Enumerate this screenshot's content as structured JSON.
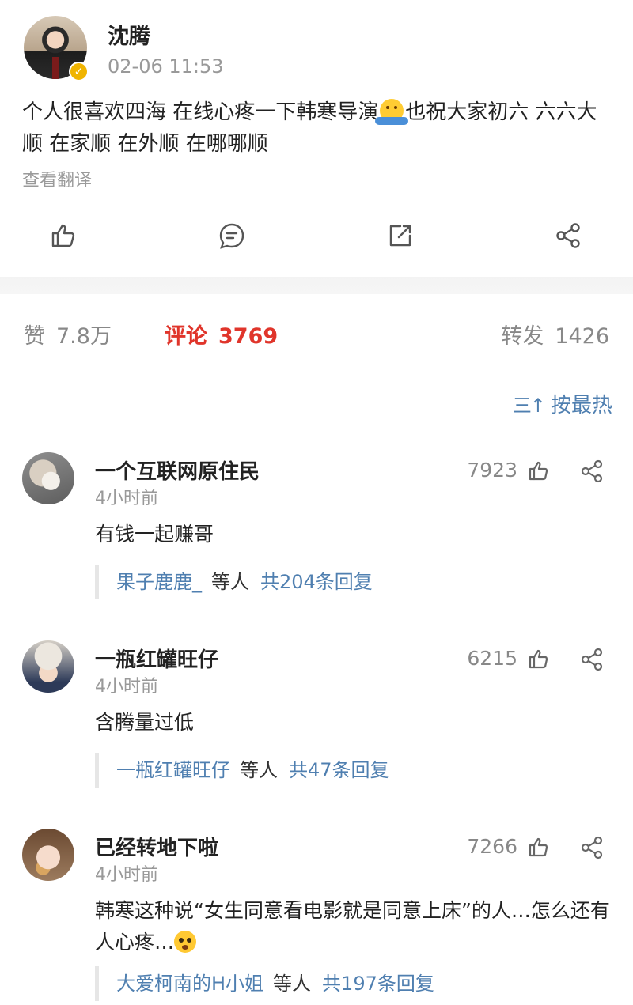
{
  "post": {
    "author": "沈腾",
    "time": "02-06 11:53",
    "text_before_emoji": "个人很喜欢四海 在线心疼一下韩寒导演",
    "text_after_emoji": "也祝大家初六 六六大顺 在家顺 在外顺 在哪哪顺",
    "translate_link": "查看翻译"
  },
  "stats": {
    "likes_label": "赞",
    "likes_count": "7.8万",
    "comments_label": "评论",
    "comments_count": "3769",
    "reposts_label": "转发",
    "reposts_count": "1426"
  },
  "sort": {
    "label": "按最热",
    "icon_text": "三↑"
  },
  "comments": [
    {
      "name": "一个互联网原住民",
      "time": "4小时前",
      "likes": "7923",
      "text": "有钱一起赚哥",
      "reply_user": "果子鹿鹿_",
      "reply_mid": "等人",
      "reply_total": "共204条回复"
    },
    {
      "name": "一瓶红罐旺仔",
      "time": "4小时前",
      "likes": "6215",
      "text": "含腾量过低",
      "reply_user": "一瓶红罐旺仔",
      "reply_mid": "等人",
      "reply_total": "共47条回复"
    },
    {
      "name": "已经转地下啦",
      "time": "4小时前",
      "likes": "7266",
      "text": "韩寒这种说“女生同意看电影就是同意上床”的人…怎么还有人心疼…",
      "reply_user": "大爱柯南的H小姐",
      "reply_mid": "等人",
      "reply_total": "共197条回复"
    }
  ],
  "icons": {
    "action_like": "thumb-up-icon",
    "action_comment": "comment-icon",
    "action_repost": "repost-icon",
    "action_share": "share-icon",
    "verified": "verified-badge-icon"
  },
  "colors": {
    "accent_red": "#e0352b",
    "link_blue": "#4f7fb0",
    "muted_gray": "#888888",
    "verified_gold": "#f0b400"
  }
}
